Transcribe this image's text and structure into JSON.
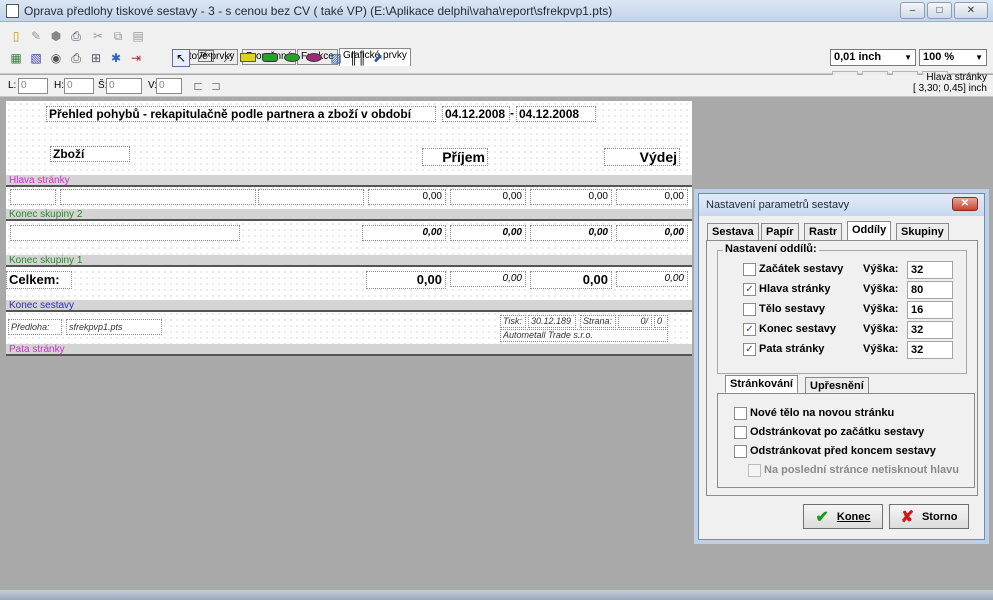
{
  "window": {
    "title": "Oprava předlohy tiskové sestavy - 3 - s cenou bez CV ( také VP) (E:\\Aplikace delphi\\vaha\\report\\sfrekpvp1.pts)",
    "min": "–",
    "max": "□",
    "close": "✕"
  },
  "toolbar": {
    "tabs": [
      "Datové prvky",
      "Proměnné",
      "Funkce",
      "Grafické prvky"
    ],
    "active_tab": "Grafické prvky",
    "zoom_unit": "0,01 inch",
    "zoom_percent": "100 %",
    "section_info_name": "Hlava stránky",
    "section_info_coords": "[ 3,30; 0,45] inch"
  },
  "coords": {
    "fields": [
      {
        "label": "L:",
        "value": "0"
      },
      {
        "label": "H:",
        "value": "0"
      },
      {
        "label": "Š:",
        "value": "0"
      },
      {
        "label": "V:",
        "value": "0"
      }
    ]
  },
  "report": {
    "header_title": "Přehled pohybů - rekapitulačně podle partnera a zboží v období",
    "date_from": "04.12.2008",
    "date_sep": "-",
    "date_to": "04.12.2008",
    "col_goods": "Zboží",
    "col_income": "Příjem",
    "col_issue": "Výdej",
    "bands": {
      "page_header": "Hlava stránky",
      "group_end_2": "Konec skupiny 2",
      "group_end_1": "Konec skupiny 1",
      "report_end": "Konec sestavy",
      "page_footer": "Pata stránky"
    },
    "zero": "0,00",
    "total_label": "Celkem:",
    "template_label": "Předloha:",
    "template_file": "sfrekpvp1.pts",
    "print_label": "Tisk:",
    "print_value": "30.12.189",
    "page_label": "Strana:",
    "page_value": "0/",
    "page_total": "0",
    "company": "Autometall Trade s.r.o."
  },
  "dialog": {
    "title": "Nastavení parametrů sestavy",
    "tabs": [
      "Sestava",
      "Papír",
      "Rastr",
      "Oddíly",
      "Skupiny"
    ],
    "active_tab": "Oddíly",
    "group_title": "Nastavení oddílů:",
    "height_label": "Výška:",
    "sections": [
      {
        "label": "Začátek sestavy",
        "checked": false,
        "height": "32"
      },
      {
        "label": "Hlava stránky",
        "checked": true,
        "height": "80"
      },
      {
        "label": "Tělo sestavy",
        "checked": false,
        "height": "16"
      },
      {
        "label": "Konec sestavy",
        "checked": true,
        "height": "32"
      },
      {
        "label": "Pata stránky",
        "checked": true,
        "height": "32"
      }
    ],
    "subtabs": [
      "Stránkování",
      "Upřesnění"
    ],
    "active_subtab": "Stránkování",
    "paging": [
      {
        "label": "Nové tělo na novou stránku",
        "checked": false,
        "disabled": false
      },
      {
        "label": "Odstránkovat po začátku sestavy",
        "checked": false,
        "disabled": false
      },
      {
        "label": "Odstránkovat před koncem sestavy",
        "checked": false,
        "disabled": false
      },
      {
        "label": "Na poslední stránce netisknout hlavu",
        "checked": false,
        "disabled": true
      }
    ],
    "ok_label": "Konec",
    "cancel_label": "Storno"
  },
  "colors": {
    "band_page_header": "#cc33cc",
    "band_group": "#2a8a2a",
    "band_report_end": "#2a2acc",
    "band_page_footer": "#cc33cc",
    "ok_icon": "#1a9a1a",
    "cancel_icon": "#cc1a1a"
  }
}
